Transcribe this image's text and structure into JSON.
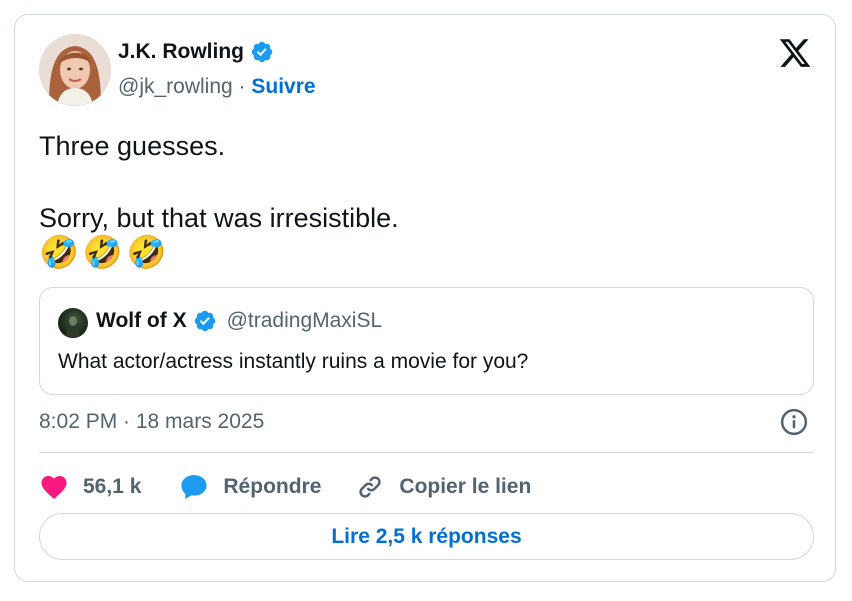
{
  "author": {
    "name": "J.K. Rowling",
    "handle": "@jk_rowling",
    "separator": "·",
    "follow_label": "Suivre"
  },
  "tweet": {
    "text": "Three guesses.\n\nSorry, but that was irresistible.",
    "emojis": [
      "🤣",
      "🤣",
      "🤣"
    ]
  },
  "quoted": {
    "name": "Wolf of X",
    "handle": "@tradingMaxiSL",
    "text": "What actor/actress instantly ruins a movie for you?"
  },
  "timestamp": "8:02 PM · 18 mars 2025",
  "actions": {
    "likes": "56,1 k",
    "reply_label": "Répondre",
    "copy_label": "Copier le lien"
  },
  "replies_button": "Lire 2,5 k réponses",
  "icons": {
    "logo": "x-logo-icon",
    "verified": "verified-badge-icon",
    "info": "info-icon",
    "like": "heart-icon",
    "reply": "speech-bubble-icon",
    "copy": "link-icon"
  },
  "colors": {
    "accent": "#006fd6",
    "verified": "#1d9bf0",
    "like": "#f91880",
    "muted": "#536471",
    "border": "#cfd9de"
  }
}
